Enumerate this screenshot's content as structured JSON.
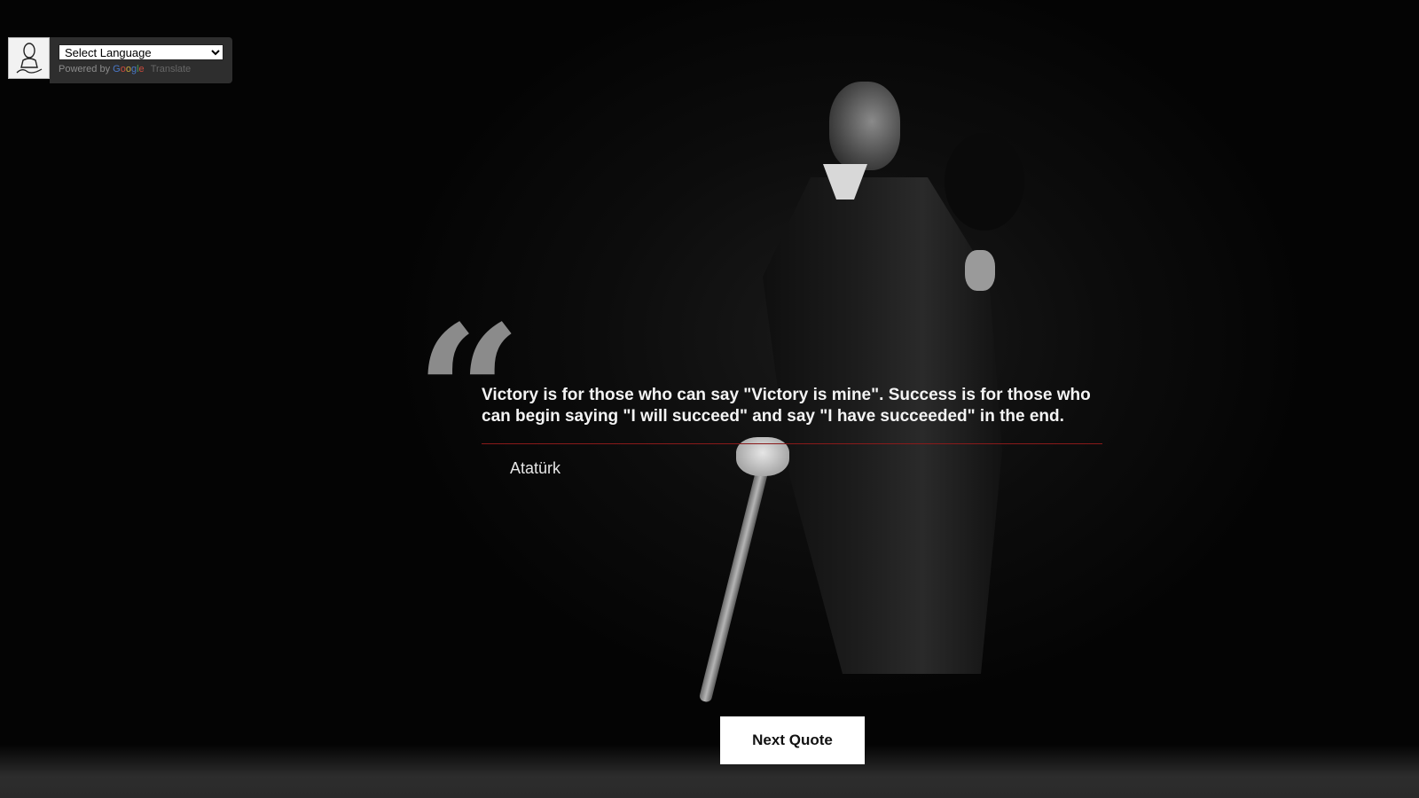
{
  "translate_widget": {
    "select_label": "Select Language",
    "powered_by": "Powered by",
    "google_letters": [
      "G",
      "o",
      "o",
      "g",
      "l",
      "e"
    ],
    "translate_link": "Translate"
  },
  "quote": {
    "mark": "“",
    "text": "Victory is for those who can say \"Victory is mine\". Success is for those who can begin saying \"I will succeed\" and say \"I have succeeded\" in the end.",
    "author": "Atatürk"
  },
  "next_button_label": "Next Quote",
  "colors": {
    "background": "#050505",
    "divider": "#8a1a1a",
    "quote_mark": "#8b8b8b",
    "button_bg": "#ffffff"
  }
}
